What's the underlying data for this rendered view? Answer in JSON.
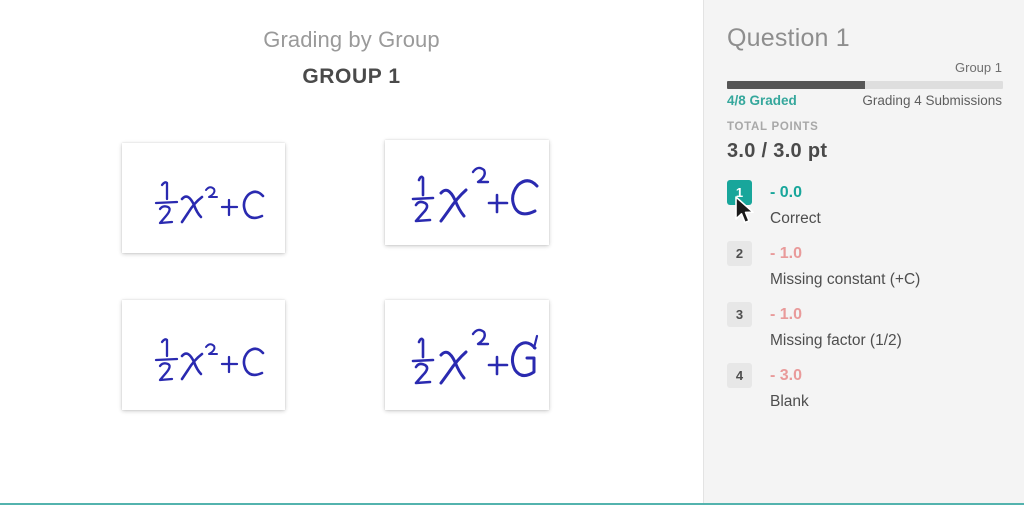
{
  "left": {
    "grading_mode_label": "Grading by Group",
    "group_title": "GROUP 1",
    "submissions": [
      {
        "answer_text": "1/2 x^2 + C",
        "style": "compact"
      },
      {
        "answer_text": "1/2 x^2 + C",
        "style": "wide"
      },
      {
        "answer_text": "1/2 x^2 + C",
        "style": "compact"
      },
      {
        "answer_text": "1/2 x^2 + C",
        "style": "wide-g"
      }
    ]
  },
  "right": {
    "question_title": "Question 1",
    "group_tag": "Group 1",
    "progress": {
      "graded": 4,
      "total": 8,
      "percent": 50,
      "graded_label": "4/8 Graded",
      "status_label": "Grading 4 Submissions"
    },
    "total_points_label": "TOTAL POINTS",
    "total_points_value": "3.0 / 3.0 pt",
    "rubric_items": [
      {
        "key": "1",
        "points": "- 0.0",
        "description": "Correct",
        "selected": true
      },
      {
        "key": "2",
        "points": "- 1.0",
        "description": "Missing constant (+C)",
        "selected": false
      },
      {
        "key": "3",
        "points": "- 1.0",
        "description": "Missing factor (1/2)",
        "selected": false
      },
      {
        "key": "4",
        "points": "- 3.0",
        "description": "Blank",
        "selected": false
      }
    ]
  },
  "colors": {
    "accent_teal": "#18a69b",
    "progress_fill": "#565656",
    "progress_track": "#dedede",
    "deduction_red": "#e99a9a",
    "panel_background": "#f4f4f4",
    "ink_blue": "#2a2ab0",
    "bottom_rule": "#53b3ae"
  }
}
